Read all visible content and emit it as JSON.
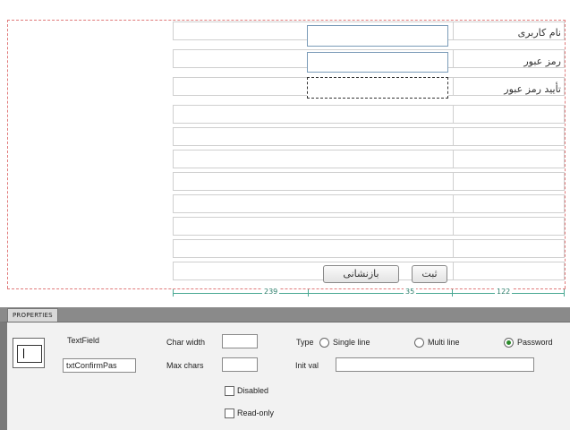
{
  "form": {
    "rows": [
      {
        "label": "نام کاربری"
      },
      {
        "label": "رمز عبور"
      },
      {
        "label": "تأیید رمز عبور"
      }
    ],
    "submit_label": "ثبت",
    "reset_label": "بازنشانی"
  },
  "ruler": {
    "left_width": "239",
    "middle_width": "35",
    "right_width": "122"
  },
  "properties": {
    "tab_label": "PROPERTIES",
    "element_type": "TextField",
    "element_id": "txtConfirmPas",
    "char_width_label": "Char width",
    "char_width_value": "",
    "max_chars_label": "Max chars",
    "max_chars_value": "",
    "type_label": "Type",
    "type_options": [
      "Single line",
      "Multi line",
      "Password"
    ],
    "type_selected": "Password",
    "init_val_label": "Init val",
    "init_val_value": "",
    "disabled_label": "Disabled",
    "readonly_label": "Read-only"
  },
  "colors": {
    "guide_dashed": "#e07a7a",
    "ruler_line": "#48a892",
    "panel_header": "#8a8a8a"
  }
}
